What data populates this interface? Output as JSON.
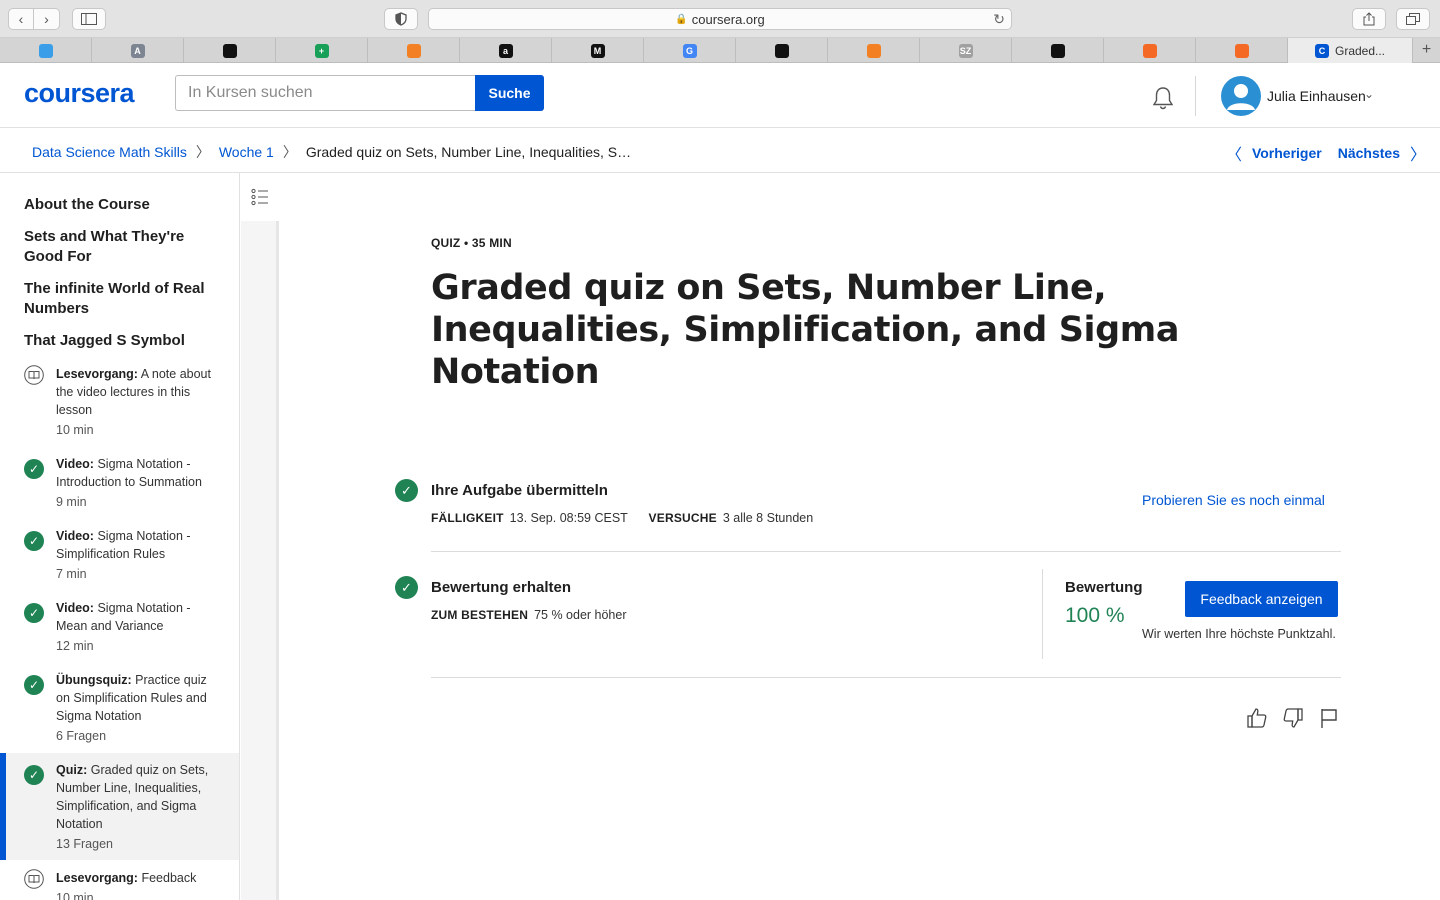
{
  "browser": {
    "url": "coursera.org",
    "tabs": [
      {
        "favicon": "blue-circle-icon",
        "color": "#3a9ee8",
        "label": ""
      },
      {
        "favicon": "a-letter-icon",
        "color": "#7d8592",
        "label": "",
        "glyph": "A"
      },
      {
        "favicon": "github-icon",
        "color": "#111111",
        "label": ""
      },
      {
        "favicon": "green-plus-icon",
        "color": "#18a058",
        "label": "",
        "glyph": "+"
      },
      {
        "favicon": "stack-icon",
        "color": "#f48024",
        "label": ""
      },
      {
        "favicon": "amazon-icon",
        "color": "#111111",
        "label": "",
        "glyph": "a"
      },
      {
        "favicon": "medium-icon",
        "color": "#111111",
        "label": "",
        "glyph": "M"
      },
      {
        "favicon": "google-icon",
        "color": "#4285f4",
        "label": "",
        "glyph": "G"
      },
      {
        "favicon": "github-icon",
        "color": "#111111",
        "label": ""
      },
      {
        "favicon": "stack-icon",
        "color": "#f48024",
        "label": ""
      },
      {
        "favicon": "sz-icon",
        "color": "#a0a0a0",
        "label": "",
        "glyph": "SZ"
      },
      {
        "favicon": "github-icon",
        "color": "#111111",
        "label": ""
      },
      {
        "favicon": "ring-icon",
        "color": "#f46a24",
        "label": ""
      },
      {
        "favicon": "book-icon",
        "color": "#f46a24",
        "label": ""
      },
      {
        "favicon": "coursera-icon",
        "color": "#0056d2",
        "label": "Graded...",
        "glyph": "C"
      }
    ]
  },
  "header": {
    "logo": "coursera",
    "search_placeholder": "In Kursen suchen",
    "search_button": "Suche",
    "user_name": "Julia Einhausen"
  },
  "breadcrumb": {
    "items": [
      "Data Science Math Skills",
      "Woche 1"
    ],
    "current": "Graded quiz on Sets, Number Line, Inequalities, S…",
    "previous": "Vorheriger",
    "next": "Nächstes"
  },
  "sidebar": {
    "sections": [
      "About the Course",
      "Sets and What They're Good For",
      "The infinite World of Real Numbers",
      "That Jagged S Symbol"
    ],
    "items": [
      {
        "type": "Lesevorgang:",
        "title": "A note about the video lectures in this lesson",
        "meta": "10 min",
        "status": "reading"
      },
      {
        "type": "Video:",
        "title": "Sigma Notation - Introduction to Summation",
        "meta": "9 min",
        "status": "done"
      },
      {
        "type": "Video:",
        "title": "Sigma Notation - Simplification Rules",
        "meta": "7 min",
        "status": "done"
      },
      {
        "type": "Video:",
        "title": "Sigma Notation - Mean and Variance",
        "meta": "12 min",
        "status": "done"
      },
      {
        "type": "Übungsquiz:",
        "title": "Practice quiz on Simplification Rules and Sigma Notation",
        "meta": "6 Fragen",
        "status": "done"
      },
      {
        "type": "Quiz:",
        "title": "Graded quiz on Sets, Number Line, Inequalities, Simplification, and Sigma Notation",
        "meta": "13 Fragen",
        "status": "done"
      },
      {
        "type": "Lesevorgang:",
        "title": "Feedback",
        "meta": "10 min",
        "status": "reading"
      }
    ]
  },
  "main": {
    "kicker": "QUIZ • 35 MIN",
    "title": "Graded quiz on Sets, Number Line, Inequalities, Simplification, and Sigma Notation",
    "submit": {
      "title": "Ihre Aufgabe übermitteln",
      "due_label": "FÄLLIGKEIT",
      "due_value": "13. Sep. 08:59 CEST",
      "attempts_label": "VERSUCHE",
      "attempts_value": "3 alle 8 Stunden",
      "retry": "Probieren Sie es noch einmal"
    },
    "grade": {
      "title": "Bewertung erhalten",
      "pass_label": "ZUM BESTEHEN",
      "pass_value": "75 % oder höher",
      "grade_label": "Bewertung",
      "grade_value": "100 %",
      "feedback_button": "Feedback anzeigen",
      "note": "Wir werten Ihre höchste Punktzahl."
    }
  },
  "colors": {
    "brand": "#0056d2",
    "success": "#1f8354"
  }
}
